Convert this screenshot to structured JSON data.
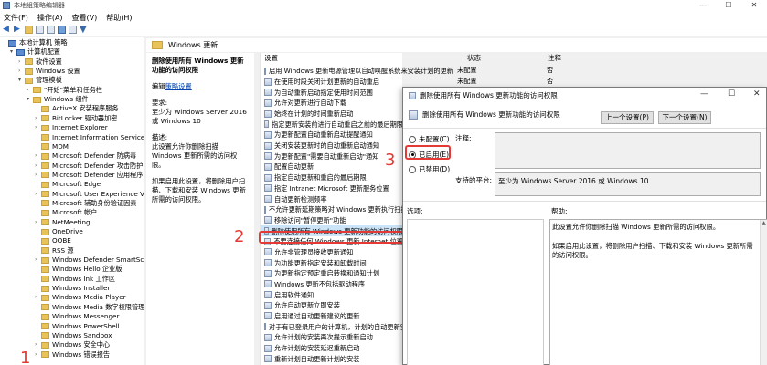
{
  "window": {
    "title": "本地组策略编辑器",
    "min": "—",
    "max": "☐",
    "close": "✕"
  },
  "menu": [
    "文件(F)",
    "操作(A)",
    "查看(V)",
    "帮助(H)"
  ],
  "tree": [
    {
      "label": "本地计算机 策略",
      "level": 0,
      "icon": "pc",
      "arrow": ""
    },
    {
      "label": "计算机配置",
      "level": 1,
      "icon": "pc",
      "arrow": "▾"
    },
    {
      "label": "软件设置",
      "level": 2,
      "icon": "folder",
      "arrow": "›"
    },
    {
      "label": "Windows 设置",
      "level": 2,
      "icon": "folder",
      "arrow": "›"
    },
    {
      "label": "管理模板",
      "level": 2,
      "icon": "folder",
      "arrow": "▾"
    },
    {
      "label": "\"开始\"菜单和任务栏",
      "level": 3,
      "icon": "folder",
      "arrow": "›"
    },
    {
      "label": "Windows 组件",
      "level": 3,
      "icon": "folder",
      "arrow": "▾"
    },
    {
      "label": "ActiveX 安装程序服务",
      "level": 4,
      "icon": "folder",
      "arrow": ""
    },
    {
      "label": "BitLocker 驱动器加密",
      "level": 4,
      "icon": "folder",
      "arrow": "›"
    },
    {
      "label": "Internet Explorer",
      "level": 4,
      "icon": "folder",
      "arrow": "›"
    },
    {
      "label": "Internet Information Services",
      "level": 4,
      "icon": "folder",
      "arrow": ""
    },
    {
      "label": "MDM",
      "level": 4,
      "icon": "folder",
      "arrow": ""
    },
    {
      "label": "Microsoft Defender 防病毒",
      "level": 4,
      "icon": "folder",
      "arrow": "›"
    },
    {
      "label": "Microsoft Defender 攻击防护",
      "level": 4,
      "icon": "folder",
      "arrow": "›"
    },
    {
      "label": "Microsoft Defender 应用程序",
      "level": 4,
      "icon": "folder",
      "arrow": "›"
    },
    {
      "label": "Microsoft Edge",
      "level": 4,
      "icon": "folder",
      "arrow": ""
    },
    {
      "label": "Microsoft User Experience Vi",
      "level": 4,
      "icon": "folder",
      "arrow": "›"
    },
    {
      "label": "Microsoft 辅助身份验证因素",
      "level": 4,
      "icon": "folder",
      "arrow": ""
    },
    {
      "label": "Microsoft 帐户",
      "level": 4,
      "icon": "folder",
      "arrow": ""
    },
    {
      "label": "NetMeeting",
      "level": 4,
      "icon": "folder",
      "arrow": "›"
    },
    {
      "label": "OneDrive",
      "level": 4,
      "icon": "folder",
      "arrow": ""
    },
    {
      "label": "OOBE",
      "level": 4,
      "icon": "folder",
      "arrow": ""
    },
    {
      "label": "RSS 源",
      "level": 4,
      "icon": "folder",
      "arrow": ""
    },
    {
      "label": "Windows Defender SmartScr",
      "level": 4,
      "icon": "folder",
      "arrow": "›"
    },
    {
      "label": "Windows Hello 企业版",
      "level": 4,
      "icon": "folder",
      "arrow": ""
    },
    {
      "label": "Windows Ink 工作区",
      "level": 4,
      "icon": "folder",
      "arrow": ""
    },
    {
      "label": "Windows Installer",
      "level": 4,
      "icon": "folder",
      "arrow": ""
    },
    {
      "label": "Windows Media Player",
      "level": 4,
      "icon": "folder",
      "arrow": "›"
    },
    {
      "label": "Windows Media 数字权限管理",
      "level": 4,
      "icon": "folder",
      "arrow": ""
    },
    {
      "label": "Windows Messenger",
      "level": 4,
      "icon": "folder",
      "arrow": ""
    },
    {
      "label": "Windows PowerShell",
      "level": 4,
      "icon": "folder",
      "arrow": ""
    },
    {
      "label": "Windows Sandbox",
      "level": 4,
      "icon": "folder",
      "arrow": ""
    },
    {
      "label": "Windows 安全中心",
      "level": 4,
      "icon": "folder",
      "arrow": "›"
    },
    {
      "label": "Windows 错误报告",
      "level": 4,
      "icon": "folder",
      "arrow": "›"
    }
  ],
  "breadcrumb": "Windows 更新",
  "desc": {
    "title": "删除使用所有 Windows 更新功能的访问权限",
    "edit_prefix": "编辑",
    "edit_link": "策略设置",
    "req_label": "要求:",
    "req_value": "至少为 Windows Server 2016 或 Windows 10",
    "desc_label": "描述:",
    "desc_text": "此设置允许你删除扫描 Windows 更新所需的访问权限。",
    "desc_text2": "如果启用此设置，将删除用户扫描、下载和安装 Windows 更新所需的访问权限。"
  },
  "list": {
    "col_setting": "设置",
    "col_status": "状态",
    "col_note": "注释",
    "rows": [
      {
        "name": "启用 Windows 更新电源管理以自动唤醒系统来安装计划的更新",
        "status": "未配置",
        "note": "否"
      },
      {
        "name": "在使用时段关闭计划更新的自动重启",
        "status": "未配置",
        "note": "否"
      },
      {
        "name": "为自动重新启动指定使用时间范围",
        "status": "未配置",
        "note": "否"
      },
      {
        "name": "允许对更新进行自动下载",
        "status": "",
        "note": ""
      },
      {
        "name": "始终在计划的时间重新启动",
        "status": "",
        "note": ""
      },
      {
        "name": "指定更新安装前进行自动重启之前的最后期限",
        "status": "",
        "note": ""
      },
      {
        "name": "为更新配置自动重新启动提醒通知",
        "status": "",
        "note": ""
      },
      {
        "name": "关闭安装更新时的自动重新启动通知",
        "status": "",
        "note": ""
      },
      {
        "name": "为更新配置\"需要自动重新启动\"通知",
        "status": "",
        "note": ""
      },
      {
        "name": "配置自动更新",
        "status": "",
        "note": ""
      },
      {
        "name": "指定自动更新和重启的最后期限",
        "status": "",
        "note": ""
      },
      {
        "name": "指定 Intranet Microsoft 更新服务位置",
        "status": "",
        "note": ""
      },
      {
        "name": "自动更新检测频率",
        "status": "",
        "note": ""
      },
      {
        "name": "不允许更新延期策略对 Windows 更新执行扫描",
        "status": "",
        "note": ""
      },
      {
        "name": "移除访问\"暂停更新\"功能",
        "status": "",
        "note": ""
      },
      {
        "name": "删除使用所有 Windows 更新功能的访问权限",
        "status": "",
        "note": "",
        "selected": true
      },
      {
        "name": "不要连接任何 Windows 更新 Internet 位置",
        "status": "",
        "note": ""
      },
      {
        "name": "允许非管理员接收更新通知",
        "status": "",
        "note": ""
      },
      {
        "name": "为功能更新指定安装和卸载时间",
        "status": "",
        "note": ""
      },
      {
        "name": "为更新指定预定重启转换和通知计划",
        "status": "",
        "note": ""
      },
      {
        "name": "Windows 更新不包括驱动程序",
        "status": "",
        "note": ""
      },
      {
        "name": "启用软件通知",
        "status": "",
        "note": ""
      },
      {
        "name": "允许自动更新立即安装",
        "status": "",
        "note": ""
      },
      {
        "name": "启用通过自动更新建议的更新",
        "status": "",
        "note": ""
      },
      {
        "name": "对于有已登录用户的计算机，计划的自动更新安装",
        "status": "",
        "note": ""
      },
      {
        "name": "允许计划的安装再次提示重新启动",
        "status": "",
        "note": ""
      },
      {
        "name": "允许计划的安装延迟重新启动",
        "status": "",
        "note": ""
      },
      {
        "name": "重新计划自动更新计划的安装",
        "status": "",
        "note": ""
      }
    ]
  },
  "dialog": {
    "title": "删除使用所有 Windows 更新功能的访问权限",
    "subtitle": "删除使用所有 Windows 更新功能的访问权限",
    "prev_button": "上一个设置(P)",
    "next_button": "下一个设置(N)",
    "radio_not_configured": "未配置(C)",
    "radio_enabled": "已启用(E)",
    "radio_disabled": "已禁用(D)",
    "comment_label": "注释:",
    "platform_label": "支持的平台:",
    "platform_value": "至少为 Windows Server 2016 或 Windows 10",
    "options_label": "选项:",
    "help_label": "帮助:",
    "help_text1": "此设置允许你删除扫描 Windows 更新所需的访问权限。",
    "help_text2": "如果启用此设置，将删除用户扫描、下载和安装 Windows 更新所需的访问权限。",
    "min": "—",
    "max": "☐",
    "close": "✕"
  },
  "annotations": {
    "n1": "1",
    "n2": "2",
    "n3": "3"
  },
  "colors": {
    "annotation_red": "#e53935",
    "selection": "#cce4f7"
  }
}
